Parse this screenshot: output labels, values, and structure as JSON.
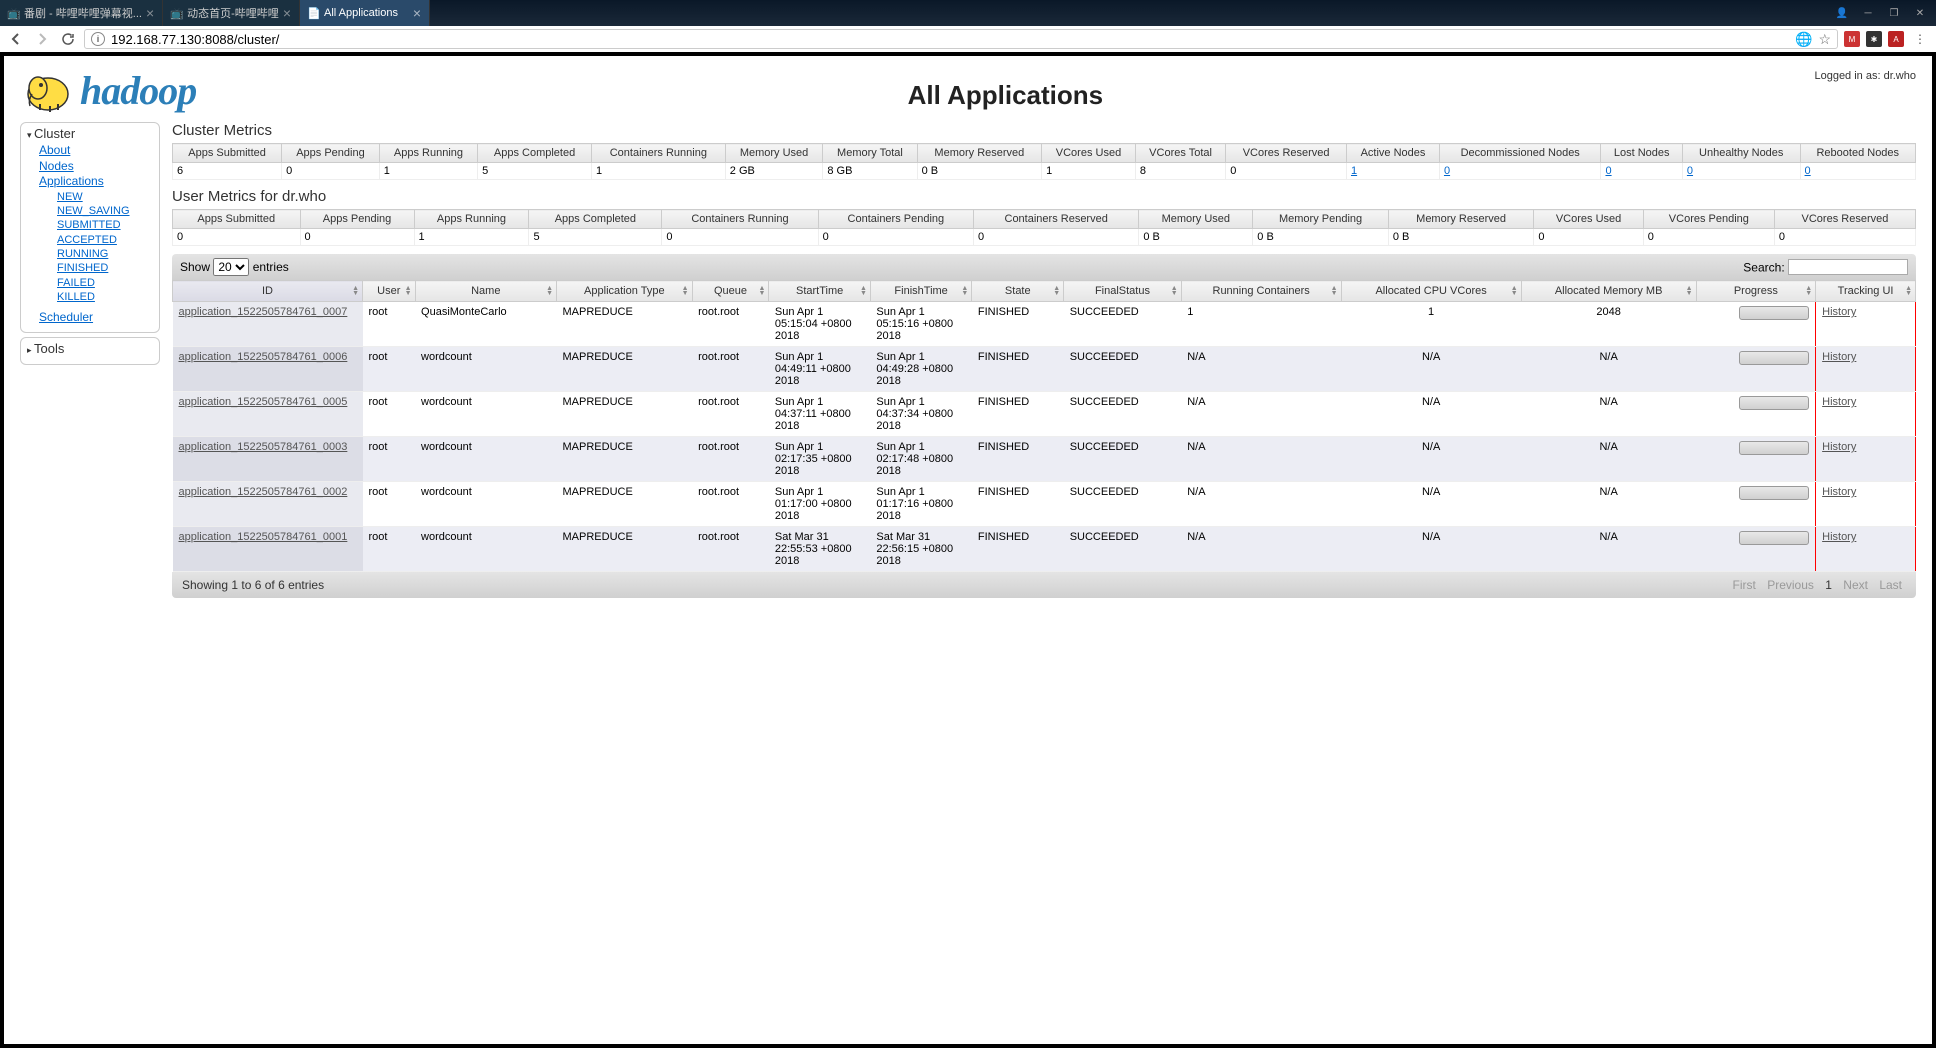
{
  "browser": {
    "tabs": [
      {
        "title": "番剧 - 哔哩哔哩弹幕视...",
        "icon": "tv",
        "active": false
      },
      {
        "title": "动态首页-哔哩哔哩",
        "icon": "tv",
        "active": false
      },
      {
        "title": "All Applications",
        "icon": "doc",
        "active": true
      }
    ],
    "url": "192.168.77.130:8088/cluster/"
  },
  "header": {
    "logo_text": "hadoop",
    "page_title": "All Applications",
    "login_info": "Logged in as: dr.who"
  },
  "sidebar": {
    "cluster": {
      "title": "Cluster",
      "links": [
        "About",
        "Nodes",
        "Applications"
      ],
      "sublinks": [
        "NEW",
        "NEW_SAVING",
        "SUBMITTED",
        "ACCEPTED",
        "RUNNING",
        "FINISHED",
        "FAILED",
        "KILLED"
      ],
      "scheduler": "Scheduler"
    },
    "tools": {
      "title": "Tools"
    }
  },
  "cluster_metrics": {
    "title": "Cluster Metrics",
    "headers": [
      "Apps Submitted",
      "Apps Pending",
      "Apps Running",
      "Apps Completed",
      "Containers Running",
      "Memory Used",
      "Memory Total",
      "Memory Reserved",
      "VCores Used",
      "VCores Total",
      "VCores Reserved",
      "Active Nodes",
      "Decommissioned Nodes",
      "Lost Nodes",
      "Unhealthy Nodes",
      "Rebooted Nodes"
    ],
    "values": [
      "6",
      "0",
      "1",
      "5",
      "1",
      "2 GB",
      "8 GB",
      "0 B",
      "1",
      "8",
      "0",
      "1",
      "0",
      "0",
      "0",
      "0"
    ]
  },
  "user_metrics": {
    "title": "User Metrics for dr.who",
    "headers": [
      "Apps Submitted",
      "Apps Pending",
      "Apps Running",
      "Apps Completed",
      "Containers Running",
      "Containers Pending",
      "Containers Reserved",
      "Memory Used",
      "Memory Pending",
      "Memory Reserved",
      "VCores Used",
      "VCores Pending",
      "VCores Reserved"
    ],
    "values": [
      "0",
      "0",
      "1",
      "5",
      "0",
      "0",
      "0",
      "0 B",
      "0 B",
      "0 B",
      "0",
      "0",
      "0"
    ]
  },
  "datatable": {
    "show_label": "Show",
    "entries_label": "entries",
    "entries_value": "20",
    "search_label": "Search:",
    "info": "Showing 1 to 6 of 6 entries",
    "paginate": {
      "first": "First",
      "prev": "Previous",
      "current": "1",
      "next": "Next",
      "last": "Last"
    }
  },
  "apps_table": {
    "headers": [
      "ID",
      "User",
      "Name",
      "Application Type",
      "Queue",
      "StartTime",
      "FinishTime",
      "State",
      "FinalStatus",
      "Running Containers",
      "Allocated CPU VCores",
      "Allocated Memory MB",
      "Progress",
      "Tracking UI"
    ],
    "rows": [
      {
        "id": "application_1522505784761_0007",
        "user": "root",
        "name": "QuasiMonteCarlo",
        "type": "MAPREDUCE",
        "queue": "root.root",
        "start": "Sun Apr 1 05:15:04 +0800 2018",
        "finish": "Sun Apr 1 05:15:16 +0800 2018",
        "state": "FINISHED",
        "finalStatus": "SUCCEEDED",
        "containers": "1",
        "vcores": "1",
        "memory": "2048",
        "tracking": "History"
      },
      {
        "id": "application_1522505784761_0006",
        "user": "root",
        "name": "wordcount",
        "type": "MAPREDUCE",
        "queue": "root.root",
        "start": "Sun Apr 1 04:49:11 +0800 2018",
        "finish": "Sun Apr 1 04:49:28 +0800 2018",
        "state": "FINISHED",
        "finalStatus": "SUCCEEDED",
        "containers": "N/A",
        "vcores": "N/A",
        "memory": "N/A",
        "tracking": "History"
      },
      {
        "id": "application_1522505784761_0005",
        "user": "root",
        "name": "wordcount",
        "type": "MAPREDUCE",
        "queue": "root.root",
        "start": "Sun Apr 1 04:37:11 +0800 2018",
        "finish": "Sun Apr 1 04:37:34 +0800 2018",
        "state": "FINISHED",
        "finalStatus": "SUCCEEDED",
        "containers": "N/A",
        "vcores": "N/A",
        "memory": "N/A",
        "tracking": "History"
      },
      {
        "id": "application_1522505784761_0003",
        "user": "root",
        "name": "wordcount",
        "type": "MAPREDUCE",
        "queue": "root.root",
        "start": "Sun Apr 1 02:17:35 +0800 2018",
        "finish": "Sun Apr 1 02:17:48 +0800 2018",
        "state": "FINISHED",
        "finalStatus": "SUCCEEDED",
        "containers": "N/A",
        "vcores": "N/A",
        "memory": "N/A",
        "tracking": "History"
      },
      {
        "id": "application_1522505784761_0002",
        "user": "root",
        "name": "wordcount",
        "type": "MAPREDUCE",
        "queue": "root.root",
        "start": "Sun Apr 1 01:17:00 +0800 2018",
        "finish": "Sun Apr 1 01:17:16 +0800 2018",
        "state": "FINISHED",
        "finalStatus": "SUCCEEDED",
        "containers": "N/A",
        "vcores": "N/A",
        "memory": "N/A",
        "tracking": "History"
      },
      {
        "id": "application_1522505784761_0001",
        "user": "root",
        "name": "wordcount",
        "type": "MAPREDUCE",
        "queue": "root.root",
        "start": "Sat Mar 31 22:55:53 +0800 2018",
        "finish": "Sat Mar 31 22:56:15 +0800 2018",
        "state": "FINISHED",
        "finalStatus": "SUCCEEDED",
        "containers": "N/A",
        "vcores": "N/A",
        "memory": "N/A",
        "tracking": "History"
      }
    ]
  }
}
